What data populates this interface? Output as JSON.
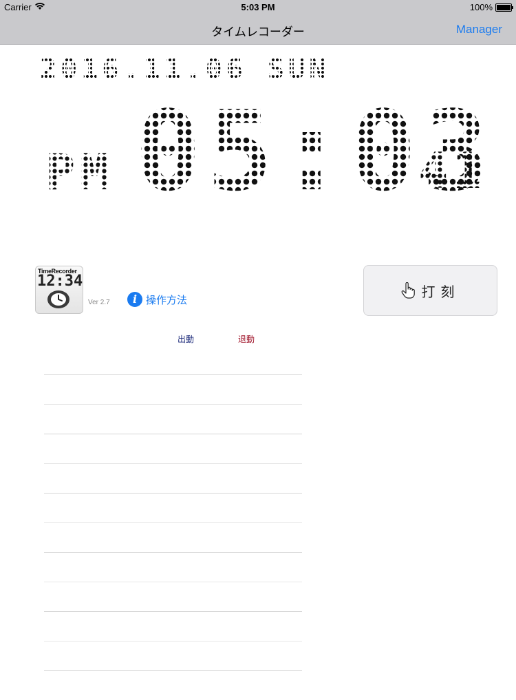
{
  "status_bar": {
    "carrier": "Carrier",
    "time": "5:03 PM",
    "battery": "100%"
  },
  "nav": {
    "title": "タイムレコーダー",
    "manager_label": "Manager"
  },
  "clock": {
    "date": "2016.11.06 SUN",
    "ampm": "PM",
    "hhmm": "05:03",
    "seconds": "41"
  },
  "app": {
    "icon_line1": "TimeRecorder",
    "icon_line2": "12:34",
    "version": "Ver 2.7",
    "help_label": "操作方法"
  },
  "stamp": {
    "label": "打刻"
  },
  "log": {
    "header_in": "出動",
    "header_out": "退動",
    "rows": [
      "",
      "",
      "",
      "",
      "",
      "",
      "",
      "",
      "",
      "",
      ""
    ]
  },
  "colors": {
    "accent": "#1a7bf0",
    "in_color": "#1c2a7a",
    "out_color": "#a0142a"
  }
}
